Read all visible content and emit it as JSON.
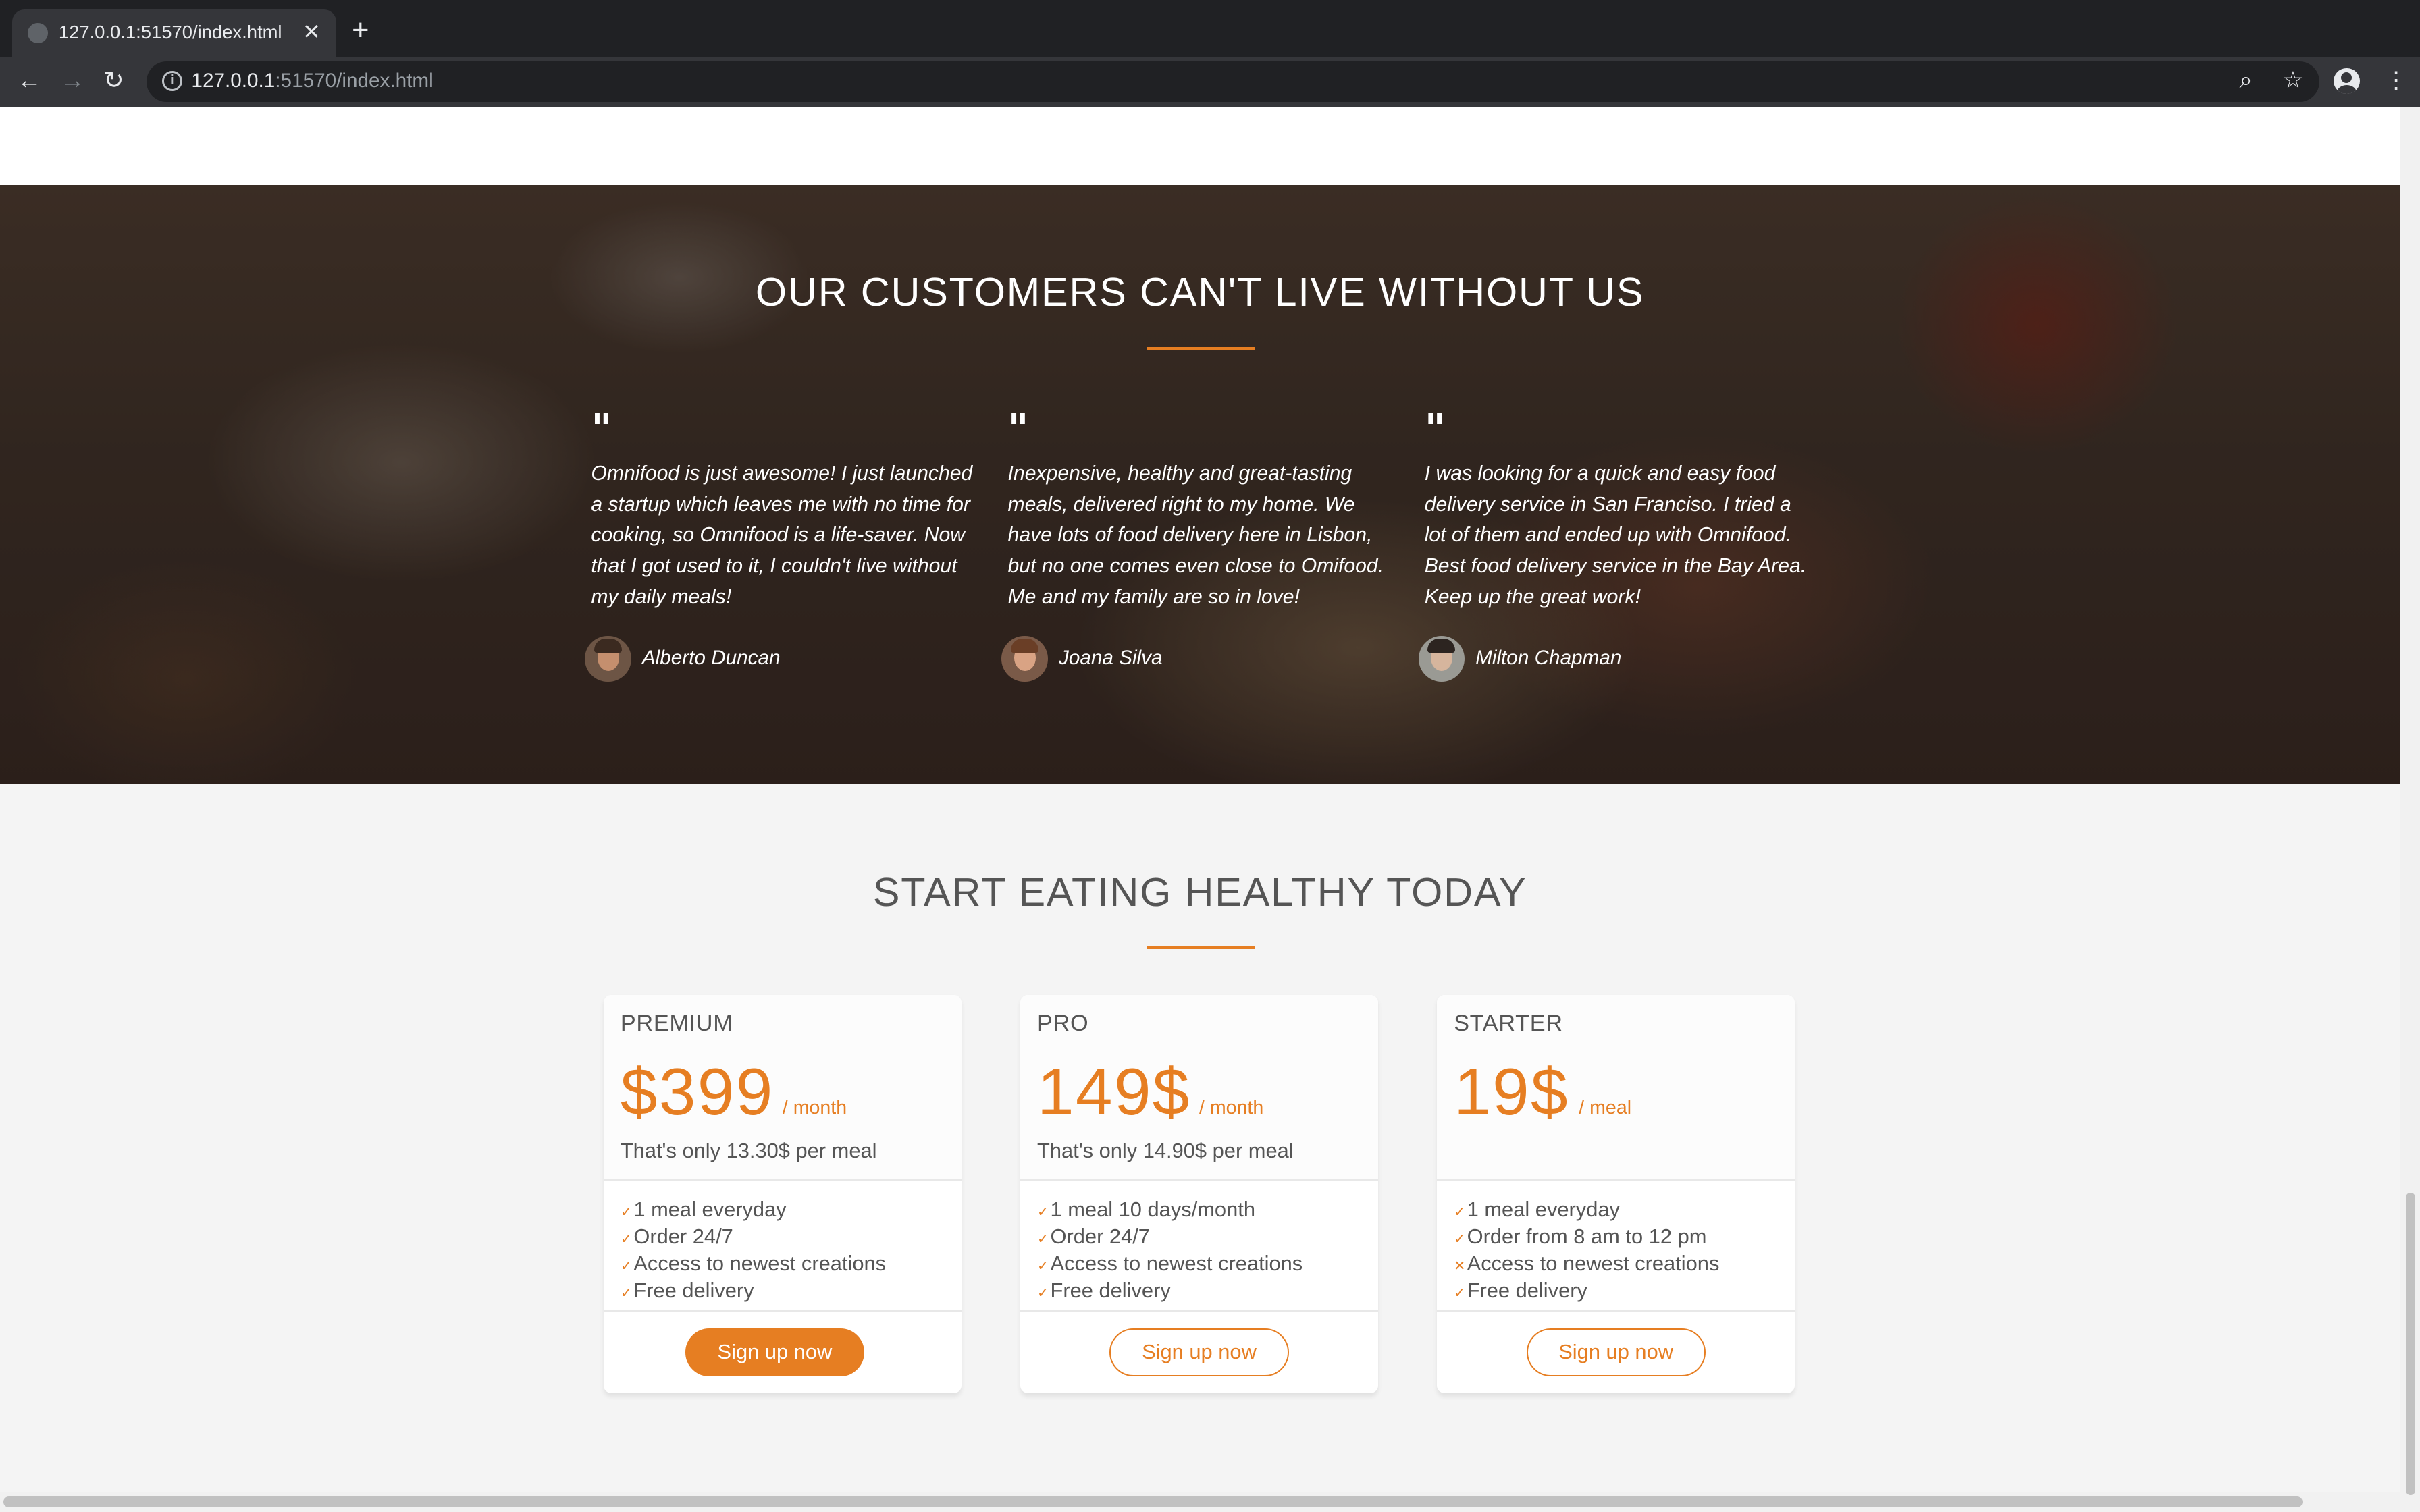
{
  "browser": {
    "tab_title": "127.0.0.1:51570/index.html",
    "tab_close": "✕",
    "new_tab": "+",
    "url_host": "127.0.0.1",
    "url_rest": ":51570/index.html"
  },
  "testimonials": {
    "title": "OUR CUSTOMERS CAN'T LIVE WITHOUT US",
    "quote_mark": "\"",
    "items": [
      {
        "text": "Omnifood is just awesome! I just launched a startup which leaves me with no time for cooking, so Omnifood is a life-saver. Now that I got used to it, I couldn't live without my daily meals!",
        "name": "Alberto Duncan"
      },
      {
        "text": "Inexpensive, healthy and great-tasting meals, delivered right to my home. We have lots of food delivery here in Lisbon, but no one comes even close to Omifood. Me and my family are so in love!",
        "name": "Joana Silva"
      },
      {
        "text": "I was looking for a quick and easy food delivery service in San Franciso. I tried a lot of them and ended up with Omnifood. Best food delivery service in the Bay Area. Keep up the great work!",
        "name": "Milton Chapman"
      }
    ]
  },
  "plans": {
    "title": "START EATING HEALTHY TODAY",
    "accent": "#e67e22",
    "items": [
      {
        "name": "PREMIUM",
        "price": "$399",
        "unit": "/ month",
        "sub": "That's only 13.30$ per meal",
        "features": [
          {
            "mark": "✓",
            "text": "1 meal everyday"
          },
          {
            "mark": "✓",
            "text": "Order 24/7"
          },
          {
            "mark": "✓",
            "text": "Access to newest creations"
          },
          {
            "mark": "✓",
            "text": "Free delivery"
          }
        ],
        "button": "Sign up now"
      },
      {
        "name": "PRO",
        "price": "149$",
        "unit": "/ month",
        "sub": "That's only 14.90$ per meal",
        "features": [
          {
            "mark": "✓",
            "text": "1 meal 10 days/month"
          },
          {
            "mark": "✓",
            "text": "Order 24/7"
          },
          {
            "mark": "✓",
            "text": "Access to newest creations"
          },
          {
            "mark": "✓",
            "text": "Free delivery"
          }
        ],
        "button": "Sign up now"
      },
      {
        "name": "STARTER",
        "price": "19$",
        "unit": "/ meal",
        "sub": "",
        "features": [
          {
            "mark": "✓",
            "text": "1 meal everyday"
          },
          {
            "mark": "✓",
            "text": "Order from 8 am to 12 pm"
          },
          {
            "mark": "✕",
            "text": "Access to newest creations"
          },
          {
            "mark": "✓",
            "text": "Free delivery"
          }
        ],
        "button": "Sign up now"
      }
    ]
  }
}
